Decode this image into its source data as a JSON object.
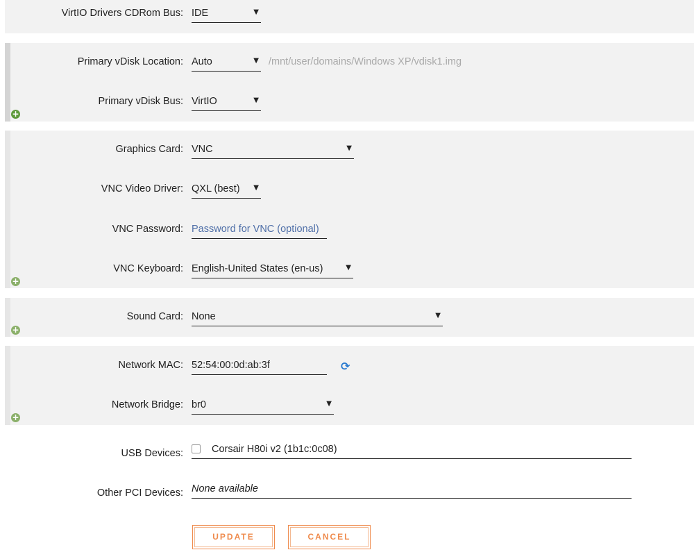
{
  "virtio": {
    "label": "VirtIO Drivers CDRom Bus:",
    "value": "IDE"
  },
  "vdisk": {
    "location_label": "Primary vDisk Location:",
    "location_value": "Auto",
    "location_path": "/mnt/user/domains/Windows XP/vdisk1.img",
    "bus_label": "Primary vDisk Bus:",
    "bus_value": "VirtIO"
  },
  "graphics": {
    "card_label": "Graphics Card:",
    "card_value": "VNC",
    "driver_label": "VNC Video Driver:",
    "driver_value": "QXL (best)",
    "password_label": "VNC Password:",
    "password_placeholder": "Password for VNC (optional)",
    "keyboard_label": "VNC Keyboard:",
    "keyboard_value": "English-United States (en-us)"
  },
  "sound": {
    "label": "Sound Card:",
    "value": "None"
  },
  "network": {
    "mac_label": "Network MAC:",
    "mac_value": "52:54:00:0d:ab:3f",
    "bridge_label": "Network Bridge:",
    "bridge_value": "br0"
  },
  "usb": {
    "label": "USB Devices:",
    "device": "Corsair H80i v2 (1b1c:0c08)",
    "checked": false
  },
  "pci": {
    "label": "Other PCI Devices:",
    "value": "None available"
  },
  "buttons": {
    "update": "UPDATE",
    "cancel": "CANCEL"
  },
  "icons": {
    "add": "plus-circle-icon",
    "refresh": "refresh-icon",
    "dropdown": "caret-down-icon"
  },
  "colors": {
    "accent": "#ef8b4d",
    "link": "#4f6fa8",
    "add_green": "#5f9a3c",
    "refresh_blue": "#2b7bd0"
  }
}
